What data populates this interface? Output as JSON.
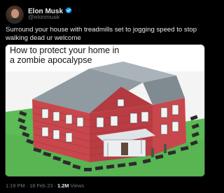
{
  "author": {
    "name": "Elon Musk",
    "handle": "@elonmusk",
    "verified_color": "#1d9bf0"
  },
  "tweet": {
    "text": "Surround your house with treadmills set to jogging speed to stop walking dead ur welcome"
  },
  "media": {
    "title_line1": "How to protect your home in",
    "title_line2": "a zombie apocalypse"
  },
  "meta": {
    "time": "1:19 PM",
    "separator": "·",
    "date": "18 Feb 23",
    "views_count": "1.2M",
    "views_label": "Views"
  },
  "colors": {
    "background": "#000000",
    "text": "#e7e9ea",
    "secondary": "#71767b",
    "brick": "#c8474c",
    "roof": "#9aa6ad",
    "grass": "#4caf50"
  }
}
